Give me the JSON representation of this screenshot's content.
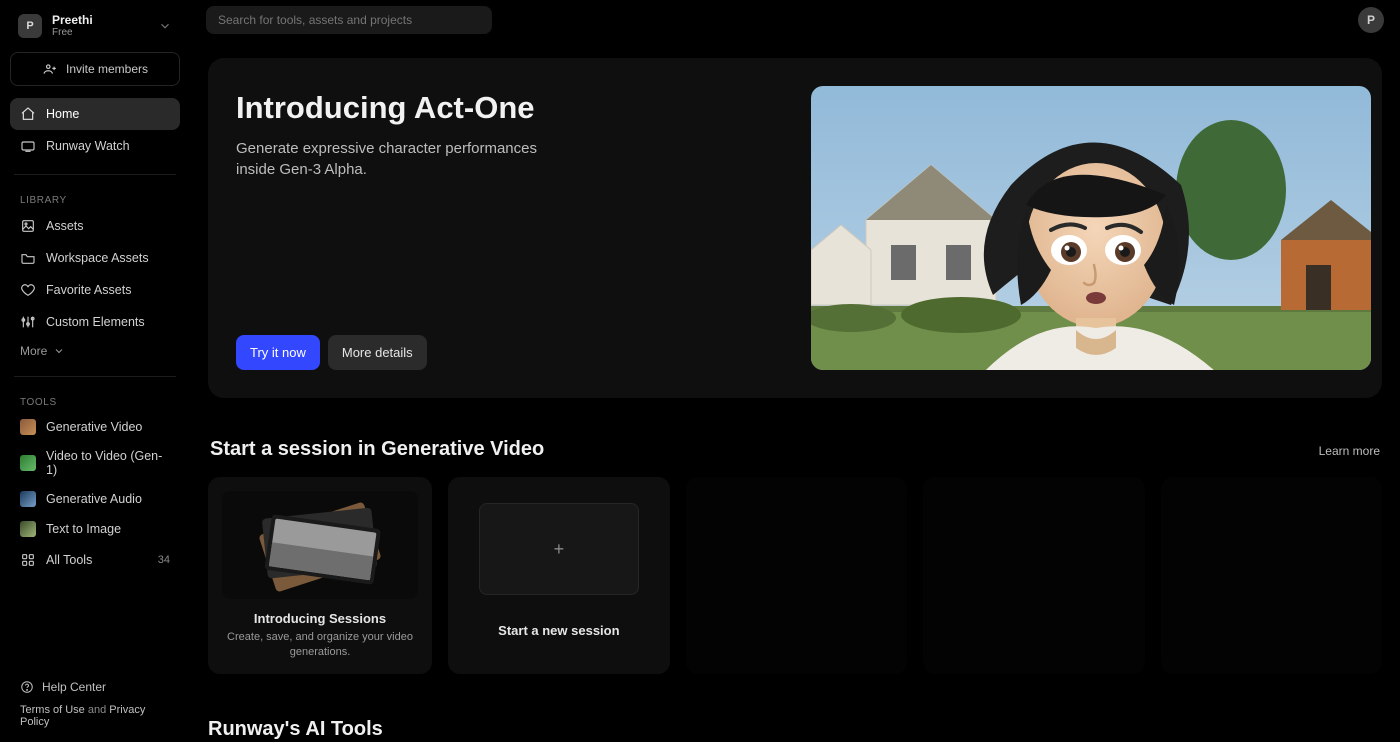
{
  "account": {
    "initial": "P",
    "name": "Preethi",
    "plan": "Free"
  },
  "invite_label": "Invite members",
  "nav": {
    "home": "Home",
    "watch": "Runway Watch"
  },
  "library": {
    "heading": "LIBRARY",
    "assets": "Assets",
    "workspace": "Workspace Assets",
    "favorites": "Favorite Assets",
    "custom": "Custom Elements",
    "more": "More"
  },
  "tools": {
    "heading": "TOOLS",
    "gen_video": "Generative Video",
    "video_to_video": "Video to Video (Gen-1)",
    "gen_audio": "Generative Audio",
    "text_to_image": "Text to Image",
    "all_tools": "All Tools",
    "all_tools_count": "34"
  },
  "footer": {
    "help": "Help Center",
    "terms": "Terms of Use",
    "sep": "and",
    "privacy": "Privacy Policy"
  },
  "search": {
    "placeholder": "Search for tools, assets and projects"
  },
  "user": {
    "initial": "P"
  },
  "hero": {
    "title": "Introducing Act-One",
    "subtitle": "Generate expressive character performances inside Gen-3 Alpha.",
    "try": "Try it now",
    "details": "More details"
  },
  "gv": {
    "title": "Start a session in Generative Video",
    "learn": "Learn more",
    "card1_title": "Introducing Sessions",
    "card1_desc": "Create, save, and organize your video generations.",
    "card2_title": "Start a new session"
  },
  "ai_tools_title": "Runway's AI Tools"
}
